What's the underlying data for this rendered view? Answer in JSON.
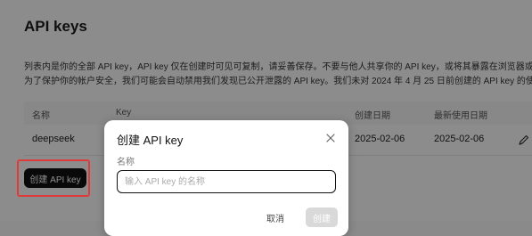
{
  "header": {
    "title": "API keys"
  },
  "description": {
    "line1": "列表内是你的全部 API key，API key 仅在创建时可见可复制，请妥善保存。不要与他人共享你的 API key，或将其暴露在浏览器或其他客户端",
    "line2": "为了保护你的帐户安全，我们可能会自动禁用我们发现已公开泄露的 API key。我们未对 2024 年 4 月 25 日前创建的 API key 的使用情况进行"
  },
  "table": {
    "columns": [
      "名称",
      "Key",
      "创建日期",
      "最新使用日期"
    ],
    "rows": [
      {
        "name": "deepseek",
        "key": "",
        "created": "2025-02-06",
        "last_used": "2025-02-06"
      }
    ]
  },
  "create_button": {
    "label": "创建 API key"
  },
  "modal": {
    "title": "创建 API key",
    "field_label": "名称",
    "input_placeholder": "输入 API key 的名称",
    "input_value": "",
    "cancel_label": "取消",
    "confirm_label": "创建"
  },
  "colors": {
    "highlight": "#e03b3b",
    "primary_button": "#111111",
    "disabled_button": "#d9d9d9"
  }
}
